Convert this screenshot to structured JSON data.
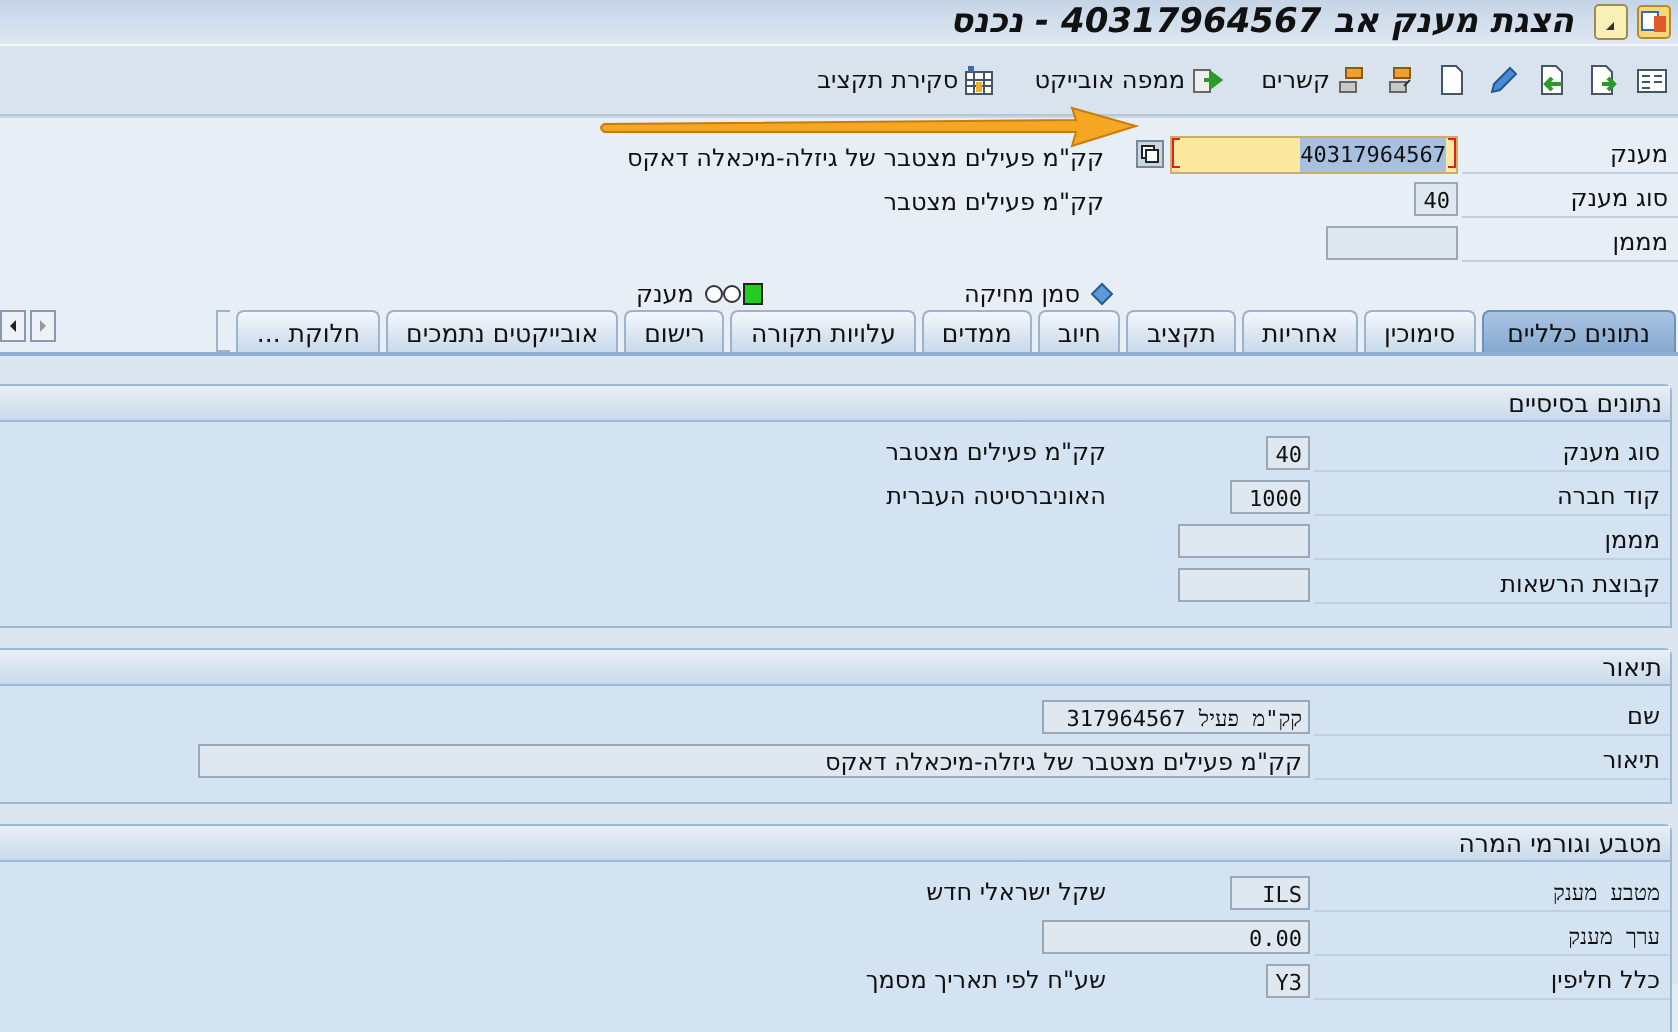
{
  "title_bar": {
    "title": "הצגת מענק אב 40317964567 - נכנס"
  },
  "toolbar": [
    {
      "label": "קשרים"
    },
    {
      "label": "ממפה אובייקט"
    },
    {
      "label": "סקירת תקציב"
    }
  ],
  "header": {
    "rows": [
      {
        "label": "מענק",
        "value": "40317964567",
        "focused": true,
        "kind": "long",
        "description": "קק\"מ פעילים מצטבר של גיזלה-מיכאלה דאקס"
      },
      {
        "label": "סוג מענק",
        "value": "40",
        "focused": false,
        "kind": "tiny",
        "description": "קק\"מ פעילים מצטבר"
      },
      {
        "label": "מממן",
        "focused": false,
        "kind": "medium"
      }
    ],
    "indicators": [
      {
        "label": "סמן מחיקה"
      },
      {
        "label": "מענק"
      }
    ]
  },
  "tabs": [
    {
      "label": "נתונים כלליים",
      "selected": true
    },
    {
      "label": "סימוכין",
      "selected": false
    },
    {
      "label": "אחריות",
      "selected": false
    },
    {
      "label": "תקציב",
      "selected": false
    },
    {
      "label": "חיוב",
      "selected": false
    },
    {
      "label": "ממדים",
      "selected": false
    },
    {
      "label": "עלויות תקורה",
      "selected": false
    },
    {
      "label": "רישום",
      "selected": false
    },
    {
      "label": "אובייקטים נתמכים",
      "selected": false
    },
    {
      "label": "חלוקת ...",
      "selected": false
    }
  ],
  "sections": [
    {
      "title": "נתונים בסיסיים",
      "rows": [
        {
          "label": "סוג מענק",
          "value": "40",
          "kind": "tiny",
          "description": "קק\"מ פעילים מצטבר"
        },
        {
          "label": "קוד חברה",
          "value": "1000",
          "kind": "short",
          "description": "האוניברסיטה העברית"
        },
        {
          "label": "מממן",
          "kind": "medium"
        },
        {
          "label": "קבוצת הרשאות",
          "kind": "medium"
        }
      ]
    },
    {
      "title": "תיאור",
      "rows": [
        {
          "label": "שם",
          "value": "קק\"מ פעיל 317964567",
          "kind": "long"
        },
        {
          "label": "תיאור",
          "value": "קק\"מ פעילים מצטבר של גיזלה-מיכאלה דאקס",
          "kind": "wide"
        }
      ]
    },
    {
      "title": "מטבע וגורמי המרה",
      "rows": [
        {
          "label": "מטבע מענק",
          "mono_label": true,
          "value": "ILS",
          "kind": "short",
          "description": "שקל ישראלי חדש"
        },
        {
          "label": "ערך מענק",
          "mono_label": true,
          "value": "0.00",
          "kind": "long"
        },
        {
          "label": "כלל חליפין",
          "mono_label": false,
          "value": "Y3",
          "kind": "tiny",
          "description": "שע\"ח לפי תאריך מסמך"
        }
      ]
    }
  ]
}
